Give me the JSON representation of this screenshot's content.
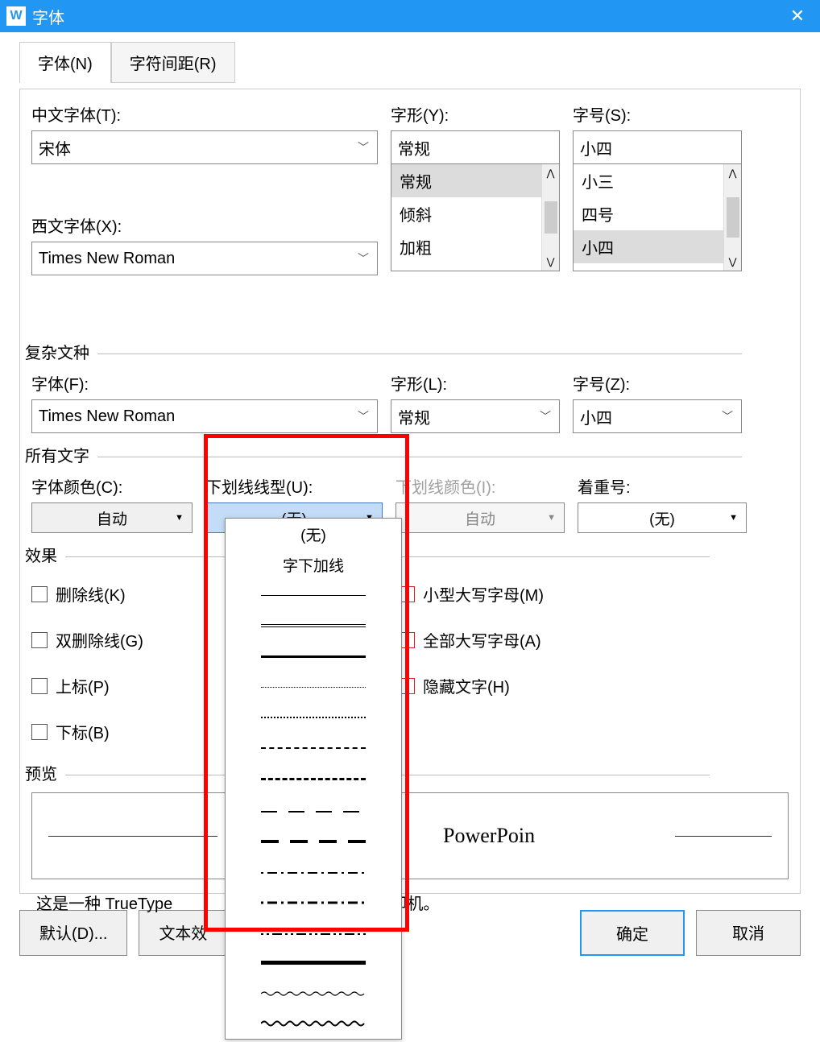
{
  "title": "字体",
  "app_icon": "W",
  "tabs": {
    "font": "字体(N)",
    "spacing": "字符间距(R)"
  },
  "labels": {
    "chinese_font": "中文字体(T):",
    "style": "字形(Y):",
    "size": "字号(S):",
    "western_font": "西文字体(X):",
    "complex_script": "复杂文种",
    "cs_font": "字体(F):",
    "cs_style": "字形(L):",
    "cs_size": "字号(Z):",
    "all_text": "所有文字",
    "font_color": "字体颜色(C):",
    "underline_style": "下划线线型(U):",
    "underline_color": "下划线颜色(I):",
    "emphasis": "着重号:",
    "effects": "效果",
    "preview": "预览"
  },
  "values": {
    "chinese_font": "宋体",
    "western_font": "Times New Roman",
    "style_input": "常规",
    "size_input": "小四",
    "cs_font": "Times New Roman",
    "cs_style": "常规",
    "cs_size": "小四",
    "font_color": "自动",
    "underline_style": "(无)",
    "underline_color": "自动",
    "emphasis": "(无)"
  },
  "style_options": [
    "常规",
    "倾斜",
    "加粗"
  ],
  "size_options": [
    "小三",
    "四号",
    "小四"
  ],
  "underline_options": {
    "none": "(无)",
    "words_only": "字下加线"
  },
  "effects": {
    "strikethrough": "删除线(K)",
    "double_strikethrough": "双删除线(G)",
    "superscript": "上标(P)",
    "subscript": "下标(B)",
    "small_caps": "小型大写字母(M)",
    "all_caps": "全部大写字母(A)",
    "hidden": "隐藏文字(H)"
  },
  "preview_text": "PowerPoin",
  "truetype_note_left": "这是一种 TrueType",
  "truetype_note_right": "和打印机。",
  "buttons": {
    "default": "默认(D)...",
    "text_effects": "文本效",
    "ok": "确定",
    "cancel": "取消"
  }
}
